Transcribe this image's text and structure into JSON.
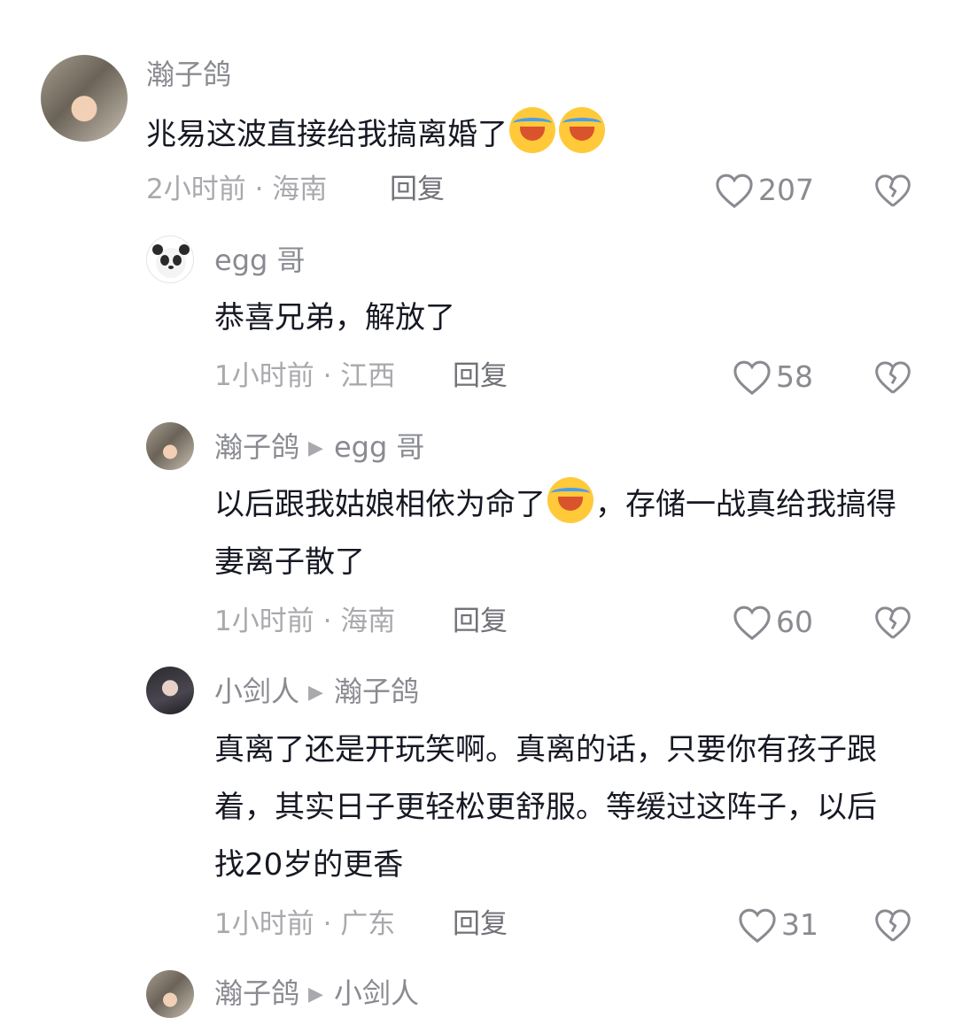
{
  "comments": [
    {
      "author": "瀚子鸽",
      "text": "兆易这波直接给我搞离婚了",
      "emoji": "loudly-crying-face",
      "emoji_count": 2,
      "meta": "2小时前 · 海南",
      "reply_label": "回复",
      "likes": "207"
    },
    {
      "author": "egg 哥",
      "text": "恭喜兄弟，解放了",
      "meta": "1小时前 · 江西",
      "reply_label": "回复",
      "likes": "58"
    },
    {
      "author": "瀚子鸽",
      "reply_to": "egg 哥",
      "text_before_emoji": "以后跟我姑娘相依为命了",
      "emoji": "loudly-crying-face",
      "text_after_emoji": "，存储一战真给我搞得妻离子散了",
      "meta": "1小时前 · 海南",
      "reply_label": "回复",
      "likes": "60"
    },
    {
      "author": "小剑人",
      "reply_to": "瀚子鸽",
      "text": "真离了还是开玩笑啊。真离的话，只要你有孩子跟着，其实日子更轻松更舒服。等缓过这阵子，以后找20岁的更香",
      "meta": "1小时前 · 广东",
      "reply_label": "回复",
      "likes": "31"
    },
    {
      "author": "瀚子鸽",
      "reply_to": "小剑人"
    }
  ],
  "colors": {
    "text_primary": "#161823",
    "text_secondary": "#8a8b91",
    "text_tertiary": "#a8a9ad",
    "background": "#ffffff"
  }
}
